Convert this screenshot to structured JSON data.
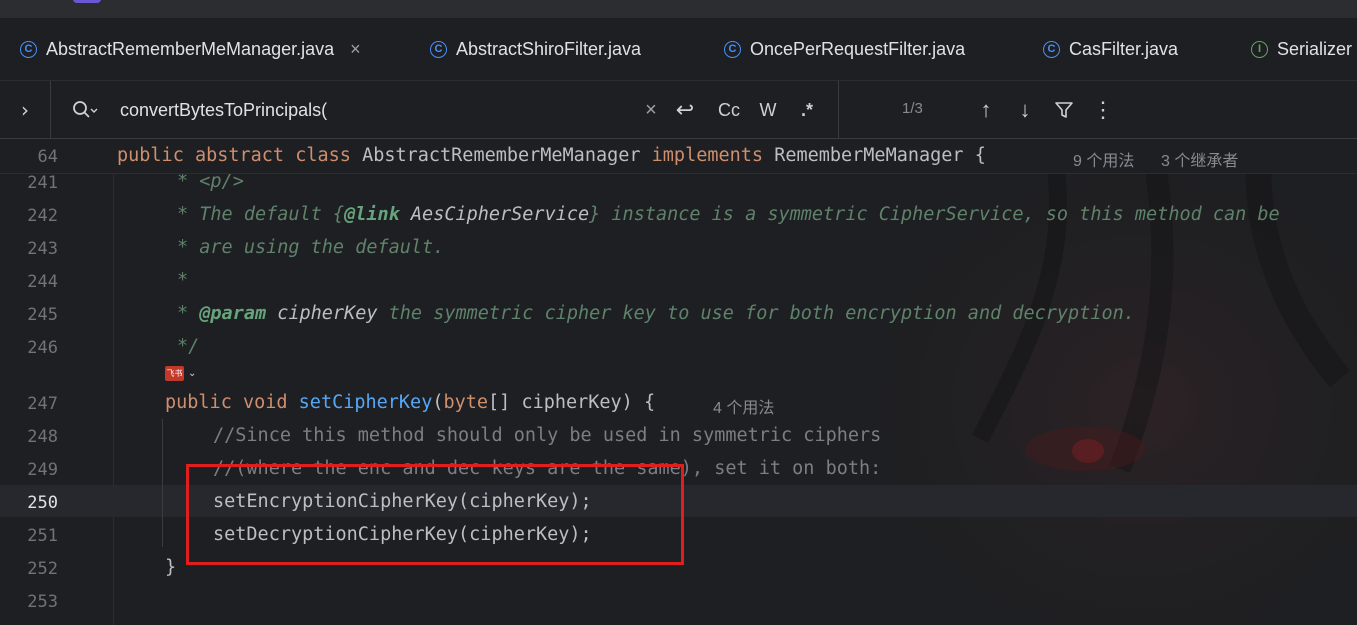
{
  "tabs": [
    {
      "label": "AbstractRememberMeManager.java",
      "icon": "class-icon",
      "active": true,
      "close": "×"
    },
    {
      "label": "AbstractShiroFilter.java",
      "icon": "class-icon"
    },
    {
      "label": "OncePerRequestFilter.java",
      "icon": "class-icon"
    },
    {
      "label": "CasFilter.java",
      "icon": "class-icon"
    },
    {
      "label": "Serializer",
      "icon": "interface-icon"
    }
  ],
  "tab_icon_glyphs": {
    "class": "C",
    "interface": "I"
  },
  "find": {
    "toggle": "›",
    "query": "convertBytesToPrincipals(",
    "clear": "×",
    "newline": "↩",
    "match_case": "Cc",
    "words": "W",
    "regex": ".*",
    "match_count": "1/3",
    "prev": "↑",
    "next": "↓",
    "more": "⋮"
  },
  "sticky": {
    "line_number": "64",
    "kw1": "public",
    "kw2": "abstract",
    "kw3": "class",
    "class_name": "AbstractRememberMeManager",
    "kw4": "implements",
    "iface": "RememberMeManager",
    "brace": "{",
    "usages": "9 个用法",
    "inheritors": "3 个继承者"
  },
  "code": {
    "ln_241": "241",
    "ln_242": "242",
    "ln_243": "243",
    "ln_244": "244",
    "ln_245": "245",
    "ln_246": "246",
    "ln_247": "247",
    "ln_248": "248",
    "ln_249": "249",
    "ln_250": "250",
    "ln_251": "251",
    "ln_252": "252",
    "ln_253": "253",
    "l241": "* <p/>",
    "l242_a": "* The default {",
    "l242_tag": "@link",
    "l242_ref": " AesCipherService",
    "l242_b": "} instance is a symmetric CipherService, so this method can be",
    "l243": "* are using the default.",
    "l244": "*",
    "l245_a": "* ",
    "l245_tag": "@param",
    "l245_ref": " cipherKey",
    "l245_b": " the symmetric cipher key to use for both encryption and decryption.",
    "l246": "*/",
    "lens_badge": "飞书",
    "lens_chevron": "⌄",
    "l247_kw1": "public",
    "l247_kw2": "void",
    "l247_fn": "setCipherKey",
    "l247_open": "(",
    "l247_kw3": "byte",
    "l247_rest": "[] cipherKey) {",
    "l247_hint": "4 个用法",
    "l248": "//Since this method should only be used in symmetric ciphers",
    "l249": "//(where the enc and dec keys are the same), set it on both:",
    "l250": "setEncryptionCipherKey(cipherKey);",
    "l251": "setDecryptionCipherKey(cipherKey);",
    "l252": "}"
  },
  "colors": {
    "accent": "#3574f0",
    "keyword": "#cf8e6d",
    "function": "#56a8f5",
    "doc_comment": "#5f826b",
    "highlight_box": "#e01e1e"
  }
}
